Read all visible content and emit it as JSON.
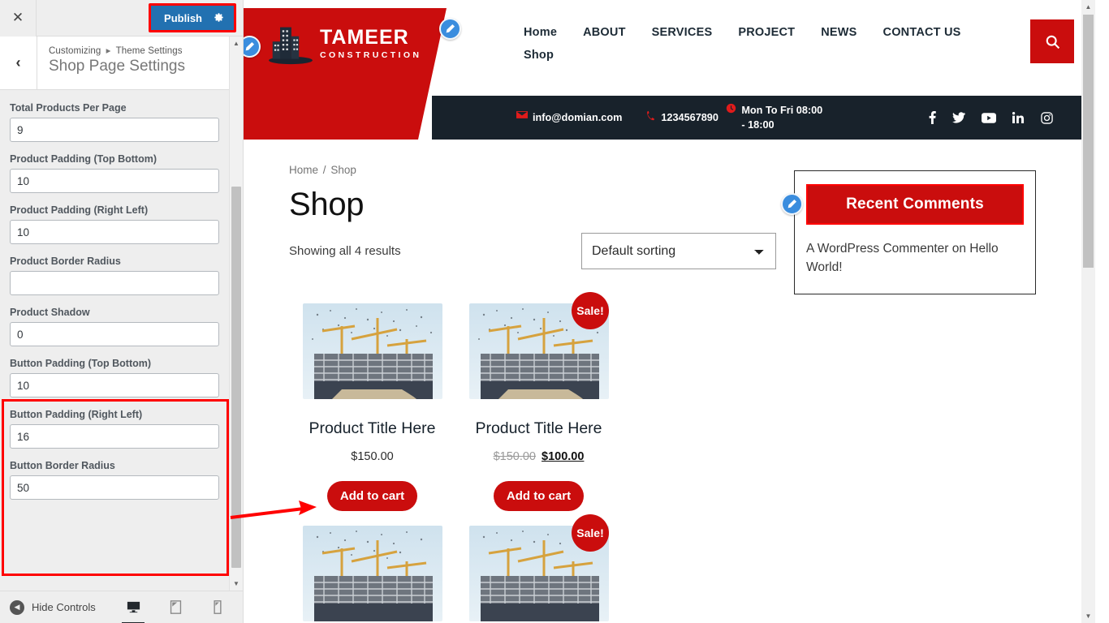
{
  "customizer": {
    "close_label": "✕",
    "publish_label": "Publish",
    "gear_icon": "gear-icon",
    "back_label": "‹",
    "breadcrumb_root": "Customizing",
    "breadcrumb_sep": "▸",
    "breadcrumb_parent": "Theme Settings",
    "panel_title": "Shop Page Settings",
    "accent_publish": "#2271b1",
    "highlight_color": "#ff0000",
    "fields": [
      {
        "label": "Total Products Per Page",
        "value": "9"
      },
      {
        "label": "Product Padding (Top Bottom)",
        "value": "10"
      },
      {
        "label": "Product Padding (Right Left)",
        "value": "10"
      },
      {
        "label": "Product Border Radius",
        "value": ""
      },
      {
        "label": "Product Shadow",
        "value": "0"
      },
      {
        "label": "Button Padding (Top Bottom)",
        "value": "10"
      },
      {
        "label": "Button Padding (Right Left)",
        "value": "16"
      },
      {
        "label": "Button Border Radius",
        "value": "50"
      }
    ],
    "footer": {
      "hide_controls_label": "Hide Controls",
      "devices": [
        {
          "name": "desktop",
          "active": true
        },
        {
          "name": "tablet",
          "active": false
        },
        {
          "name": "mobile",
          "active": false
        }
      ]
    }
  },
  "site": {
    "logo": {
      "name": "TAMEER",
      "tagline": "CONSTRUCTION",
      "brand_color": "#ca0d0d"
    },
    "nav": [
      {
        "label": "Home"
      },
      {
        "label": "ABOUT"
      },
      {
        "label": "SERVICES"
      },
      {
        "label": "PROJECT"
      },
      {
        "label": "NEWS"
      },
      {
        "label": "CONTACT US"
      },
      {
        "label": "Shop"
      }
    ],
    "search_icon": "search-icon",
    "contact_bar": {
      "bg": "#18222b",
      "email": "info@domian.com",
      "phone": "1234567890",
      "hours": "Mon To Fri 08:00 - 18:00",
      "socials": [
        "facebook",
        "twitter",
        "youtube",
        "linkedin",
        "instagram"
      ]
    }
  },
  "shop": {
    "breadcrumb_home": "Home",
    "breadcrumb_sep": "/",
    "breadcrumb_current": "Shop",
    "title": "Shop",
    "result_count": "Showing all 4 results",
    "sorting_selected": "Default sorting",
    "sorting_options": [
      "Default sorting"
    ],
    "add_to_cart_label": "Add to cart",
    "sale_badge_label": "Sale!",
    "products": [
      {
        "title": "Product Title Here",
        "price": "$150.00",
        "old_price": "",
        "on_sale": false
      },
      {
        "title": "Product Title Here",
        "price": "$100.00",
        "old_price": "$150.00",
        "on_sale": true
      },
      {
        "title": "",
        "price": "",
        "old_price": "",
        "on_sale": false
      },
      {
        "title": "",
        "price": "",
        "old_price": "",
        "on_sale": true
      }
    ]
  },
  "widget": {
    "title": "Recent Comments",
    "body": "A WordPress Commenter on Hello World!",
    "title_bg": "#ca0d0d"
  }
}
